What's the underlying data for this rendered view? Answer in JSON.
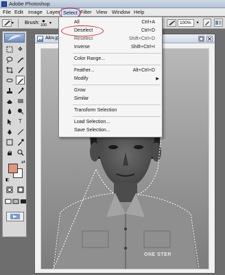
{
  "window": {
    "title": "Adobe Photoshop"
  },
  "menubar": {
    "items": [
      "File",
      "Edit",
      "Image",
      "Layer",
      "Select",
      "Filter",
      "View",
      "Window",
      "Help"
    ],
    "active": "Select"
  },
  "options_bar": {
    "brush_label": "Brush:",
    "brush_size": "100",
    "zoom_value": "100%"
  },
  "document": {
    "title": "Akiv.jpg"
  },
  "select_menu": {
    "items": [
      {
        "label": "All",
        "shortcut": "Ctrl+A"
      },
      {
        "label": "Deselect",
        "shortcut": "Ctrl+D"
      },
      {
        "label": "Reselect",
        "shortcut": "Shift+Ctrl+D"
      },
      {
        "label": "Inverse",
        "shortcut": "Shift+Ctrl+I"
      },
      {
        "label": "Color Range...",
        "shortcut": ""
      },
      {
        "label": "Feather...",
        "shortcut": "Alt+Ctrl+D"
      },
      {
        "label": "Modify",
        "shortcut": ""
      },
      {
        "label": "Grow",
        "shortcut": ""
      },
      {
        "label": "Similar",
        "shortcut": ""
      },
      {
        "label": "Transform Selection",
        "shortcut": ""
      },
      {
        "label": "Load Selection...",
        "shortcut": ""
      },
      {
        "label": "Save Selection...",
        "shortcut": ""
      }
    ]
  },
  "tools": {
    "foreground_color": "#e0967a",
    "background_color": "#ffffff"
  },
  "photo": {
    "shirt_print": "ONE STER"
  }
}
